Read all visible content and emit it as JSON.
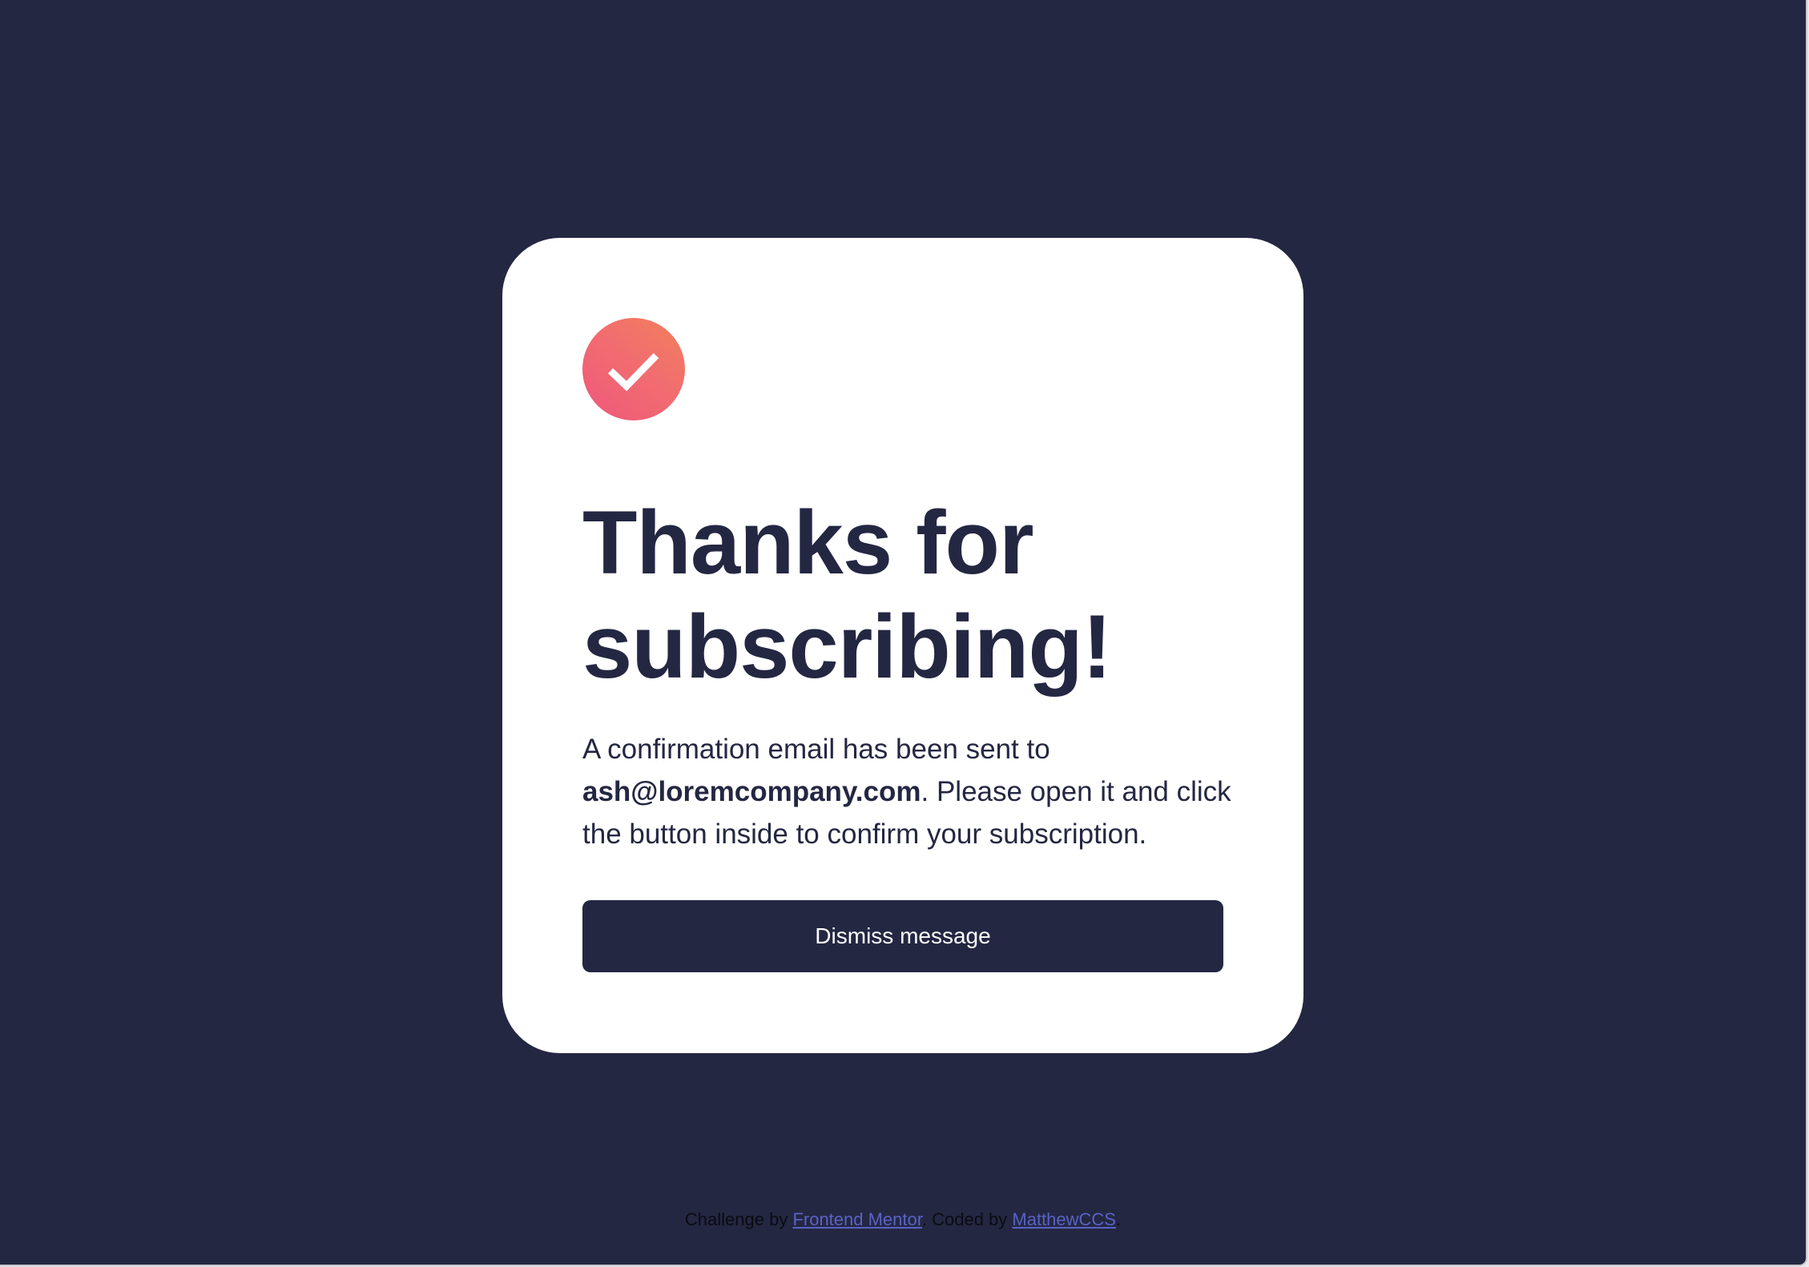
{
  "card": {
    "icon": "success-check-icon",
    "title": "Thanks for subscribing!",
    "message": {
      "before": "A confirmation email has been sent to ",
      "email": "ash@loremcompany.com",
      "after": ". Please open it and click the button inside to confirm your subscription."
    },
    "dismiss_label": "Dismiss message"
  },
  "attribution": {
    "challenge_text": "Challenge by ",
    "challenge_link": "Frontend Mentor",
    "coded_text": ". Coded by ",
    "coded_link": "MatthewCCS",
    "end_text": "."
  },
  "colors": {
    "background": "#242742",
    "card": "#ffffff",
    "text": "#242742",
    "accent_start": "#f0577c",
    "accent_end": "#f2805c",
    "link": "#5962c4"
  }
}
